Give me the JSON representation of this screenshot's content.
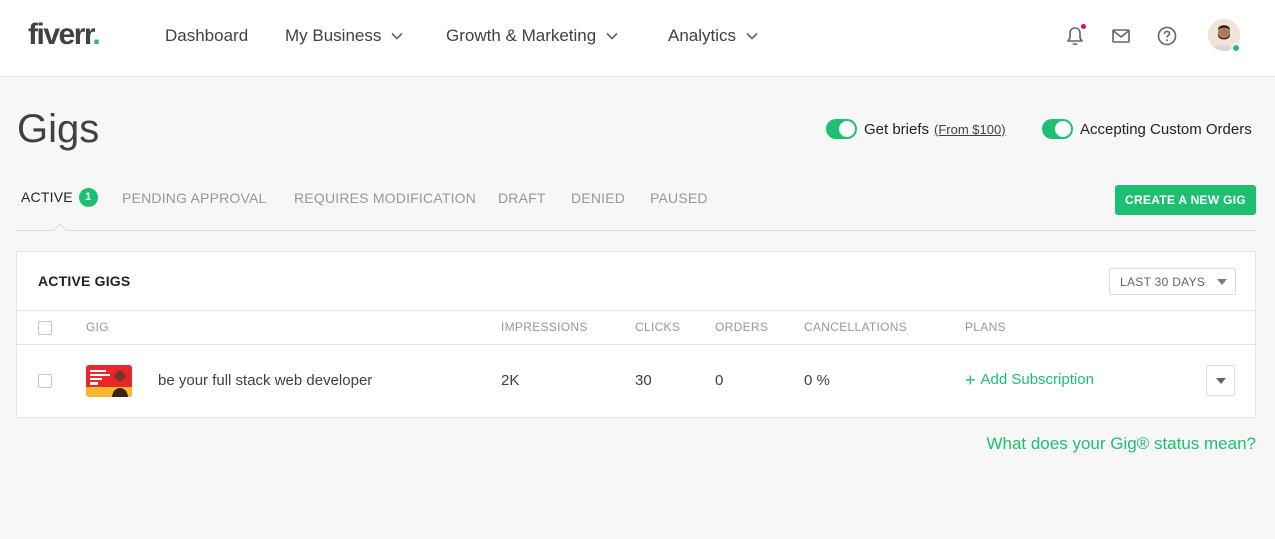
{
  "header": {
    "logo_text": "fiverr",
    "logo_dot": ".",
    "nav": [
      {
        "label": "Dashboard"
      },
      {
        "label": "My Business"
      },
      {
        "label": "Growth & Marketing"
      },
      {
        "label": "Analytics"
      }
    ]
  },
  "page": {
    "title": "Gigs",
    "toggles": [
      {
        "label": "Get briefs",
        "link": "(From $100)",
        "on": true
      },
      {
        "label": "Accepting Custom Orders",
        "on": true
      }
    ]
  },
  "tabs": [
    {
      "label": "ACTIVE",
      "count": "1",
      "active": true
    },
    {
      "label": "PENDING APPROVAL"
    },
    {
      "label": "REQUIRES MODIFICATION"
    },
    {
      "label": "DRAFT"
    },
    {
      "label": "DENIED"
    },
    {
      "label": "PAUSED"
    }
  ],
  "create_button": "CREATE A NEW GIG",
  "table": {
    "title": "ACTIVE GIGS",
    "range": "LAST 30 DAYS",
    "columns": [
      "GIG",
      "IMPRESSIONS",
      "CLICKS",
      "ORDERS",
      "CANCELLATIONS",
      "PLANS"
    ],
    "rows": [
      {
        "title": "be your full stack web developer",
        "impressions": "2K",
        "clicks": "30",
        "orders": "0",
        "cancellations": "0 %",
        "plan_action": "Add Subscription",
        "plan_icon": "+"
      }
    ]
  },
  "status_link": "What does your Gig® status mean?",
  "colors": {
    "accent": "#1dbf73",
    "text": "#404145",
    "muted": "#95979d",
    "notification_dot": "#c2185b"
  }
}
